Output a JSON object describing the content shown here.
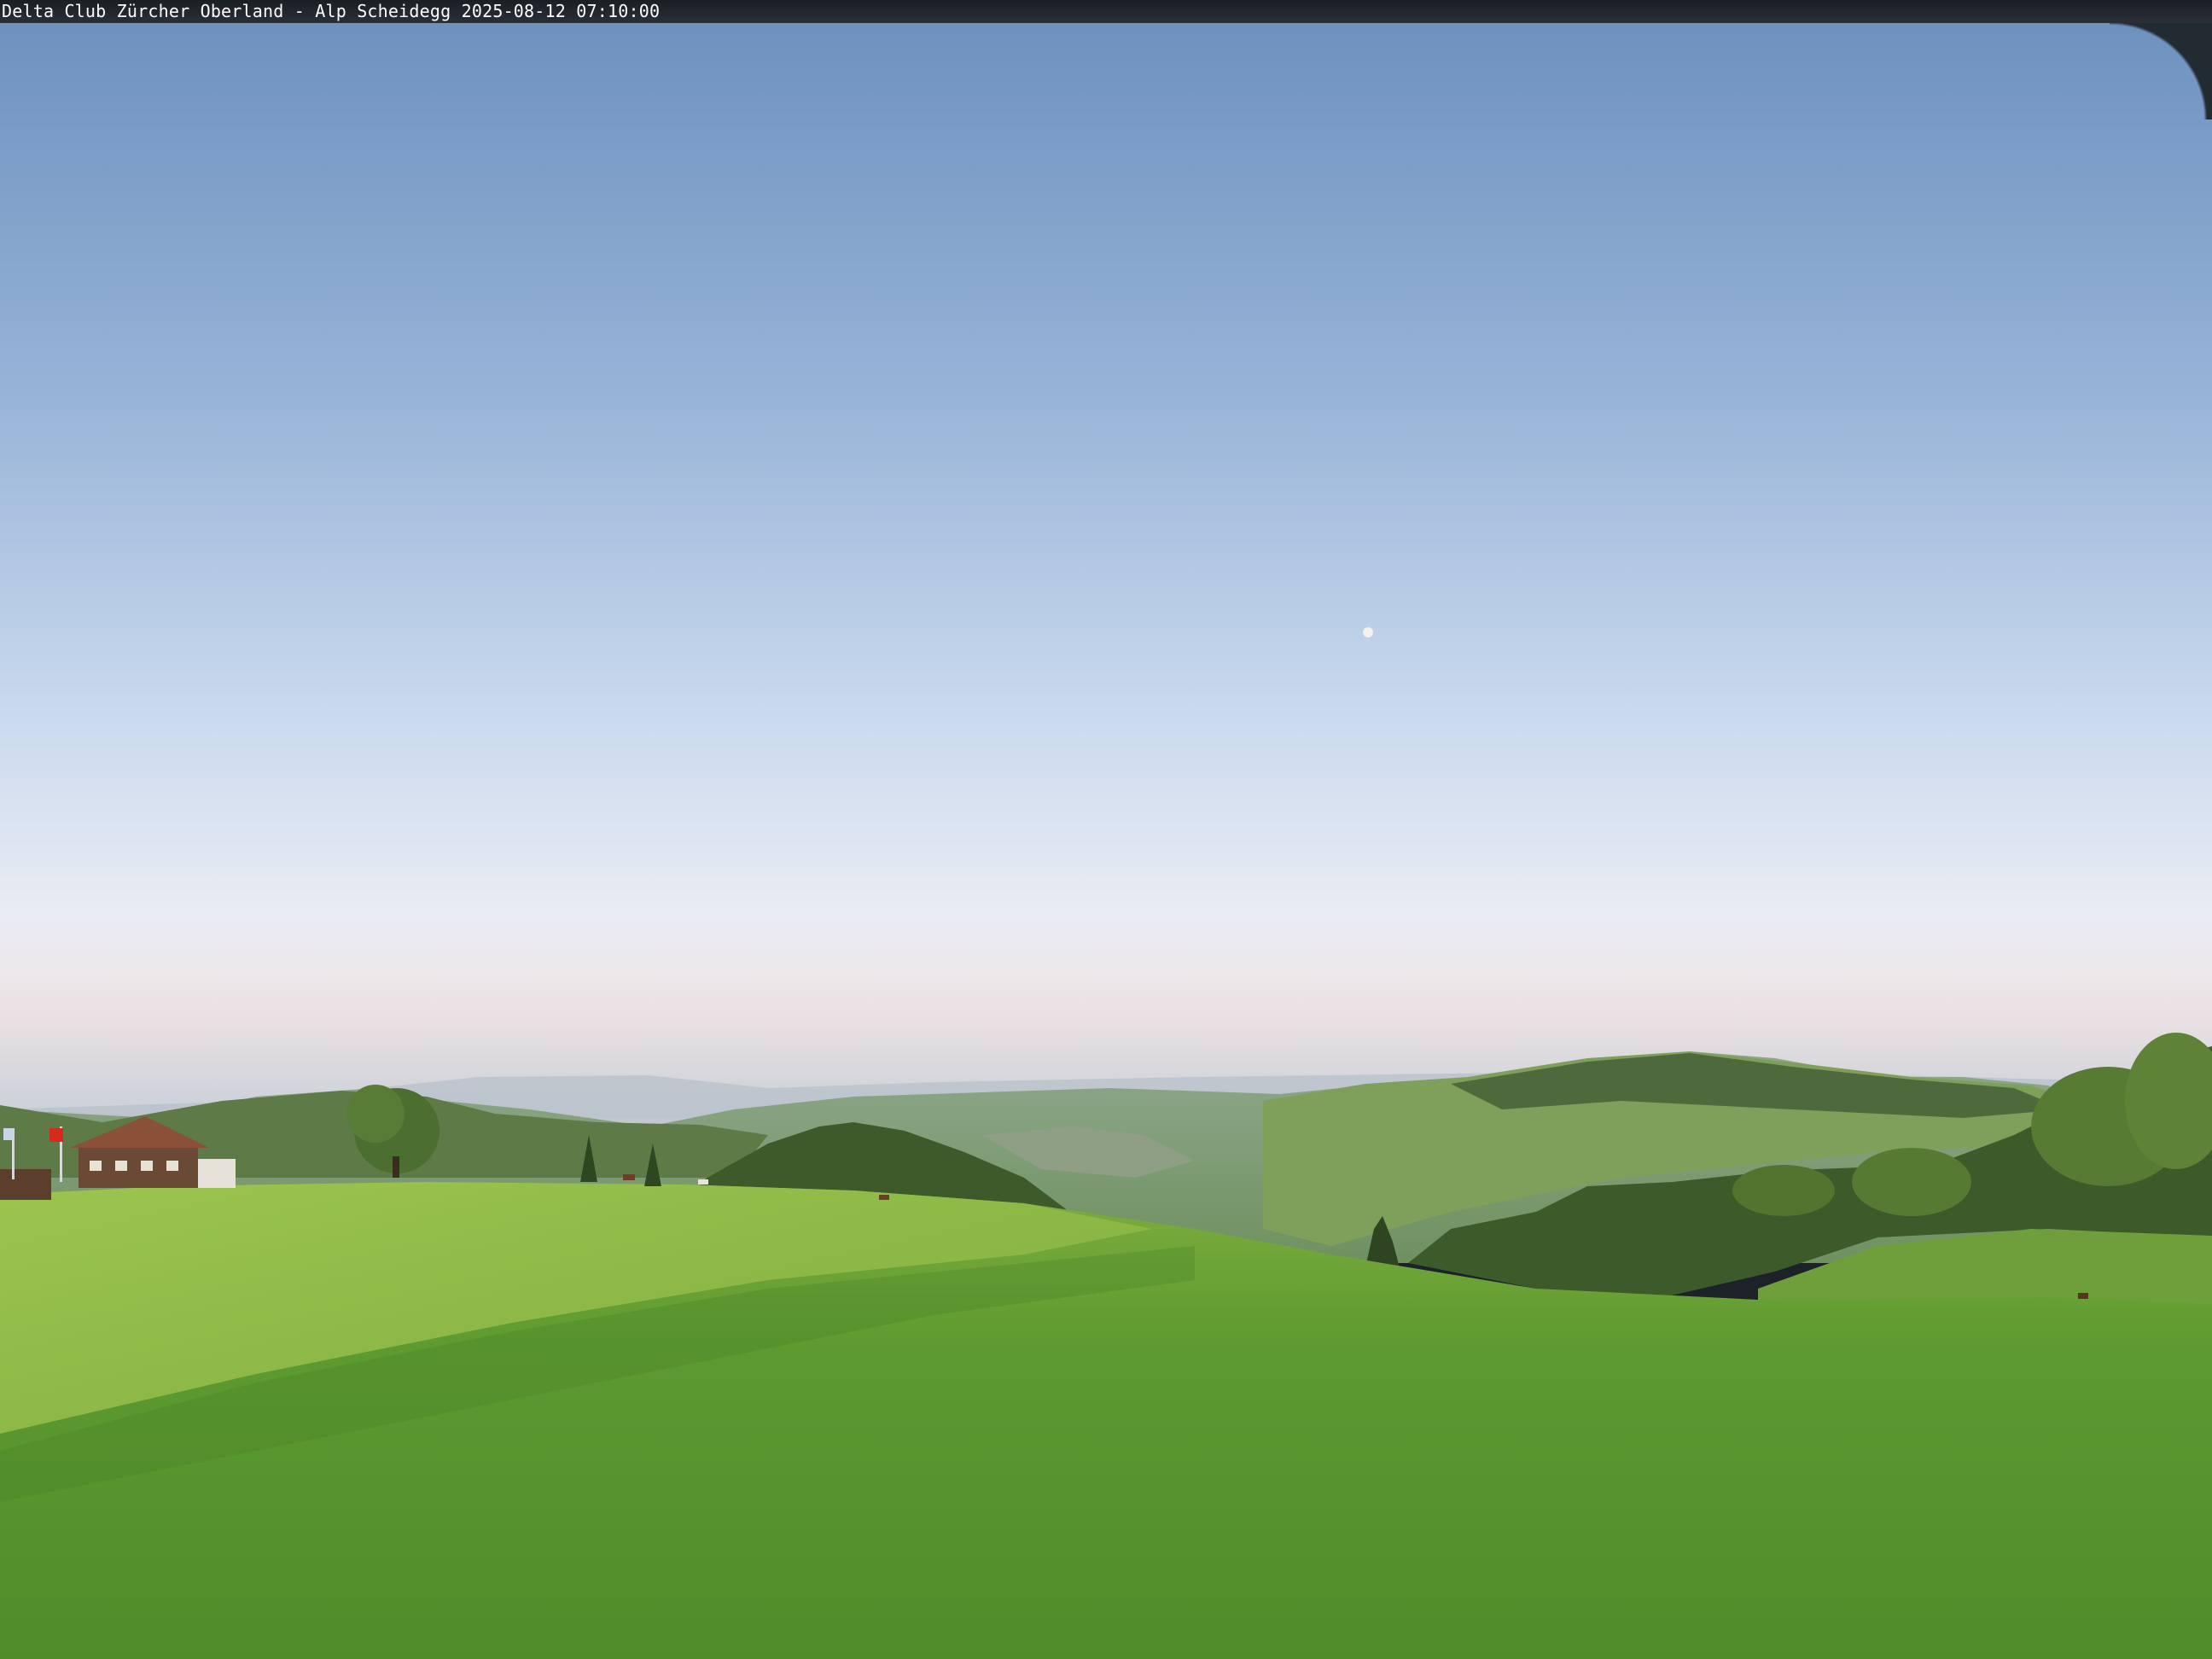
{
  "webcam": {
    "caption": "Delta Club Zürcher Oberland - Alp Scheidegg 2025-08-12 07:10:00"
  },
  "palette": {
    "sky_top": "#6f92bf",
    "sky_mid": "#a9c1e0",
    "sky_horizon": "#f1e6e4",
    "haze": "#cfd4dc",
    "distant_hills": "#7f9a86",
    "forest": "#3f5a2c",
    "meadow_light": "#7cae3c",
    "meadow_dark": "#4e8a2c"
  }
}
